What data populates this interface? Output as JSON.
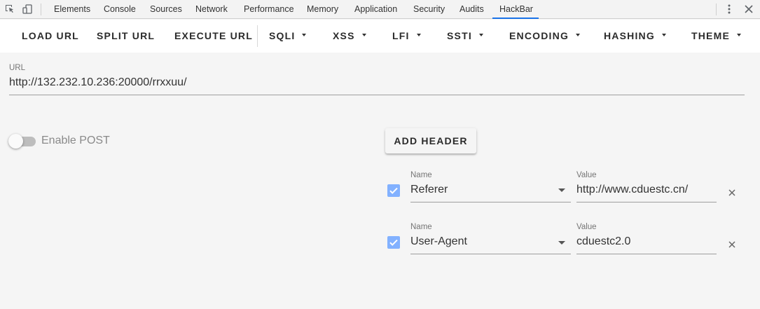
{
  "devtools": {
    "tabs": [
      {
        "label": "Elements"
      },
      {
        "label": "Console"
      },
      {
        "label": "Sources"
      },
      {
        "label": "Network"
      },
      {
        "label": "Performance"
      },
      {
        "label": "Memory"
      },
      {
        "label": "Application"
      },
      {
        "label": "Security"
      },
      {
        "label": "Audits"
      },
      {
        "label": "HackBar",
        "active": true
      }
    ],
    "accent_color": "#1a73e8"
  },
  "toolbar": {
    "load_url": "LOAD URL",
    "split_url": "SPLIT URL",
    "execute_url": "EXECUTE URL",
    "menus": [
      {
        "label": "SQLI"
      },
      {
        "label": "XSS"
      },
      {
        "label": "LFI"
      },
      {
        "label": "SSTI"
      },
      {
        "label": "ENCODING"
      },
      {
        "label": "HASHING"
      },
      {
        "label": "THEME"
      }
    ]
  },
  "url_field": {
    "label": "URL",
    "value": "http://132.232.10.236:20000/rrxxuu/"
  },
  "post_toggle": {
    "label": "Enable POST",
    "enabled": false
  },
  "add_header_label": "ADD HEADER",
  "headers": [
    {
      "name_label": "Name",
      "name": "Referer",
      "value_label": "Value",
      "value": "http://www.cduestc.cn/",
      "checked": true
    },
    {
      "name_label": "Name",
      "name": "User-Agent",
      "value_label": "Value",
      "value": "cduestc2.0",
      "checked": true
    }
  ],
  "checkbox_color": "#82b1ff"
}
